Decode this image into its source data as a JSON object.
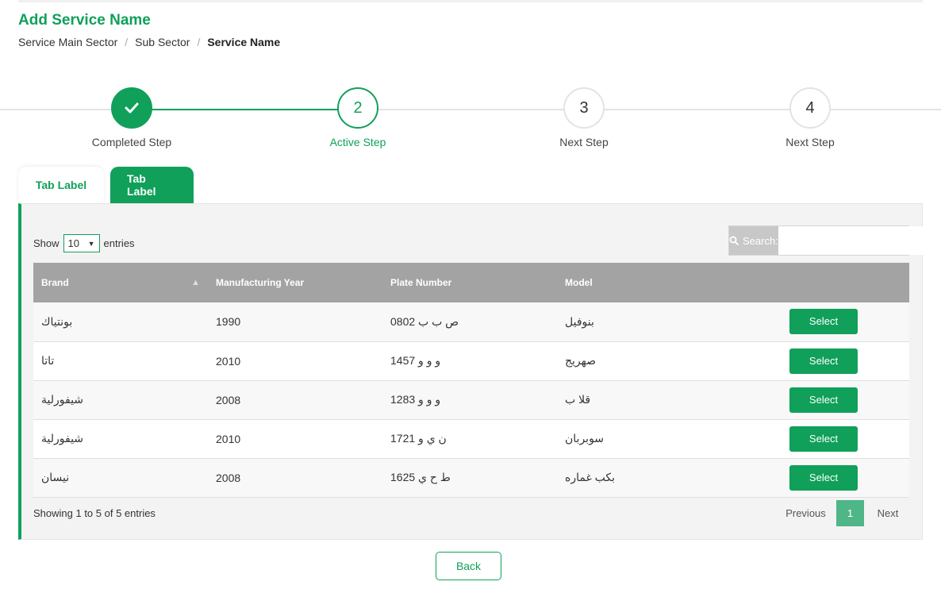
{
  "header": {
    "title": "Add Service Name",
    "breadcrumb": [
      "Service Main Sector",
      "Sub Sector",
      "Service Name"
    ]
  },
  "stepper": {
    "steps": [
      {
        "label": "Completed Step",
        "state": "completed",
        "icon": "check-icon"
      },
      {
        "label": "Active Step",
        "state": "active",
        "number": "2"
      },
      {
        "label": "Next Step",
        "state": "next",
        "number": "3"
      },
      {
        "label": "Next Step",
        "state": "next",
        "number": "4"
      }
    ]
  },
  "tabs": [
    {
      "label": "Tab Label"
    },
    {
      "label": "Tab Label"
    }
  ],
  "table_controls": {
    "show_label": "Show",
    "page_length": "10",
    "entries_label": "entries",
    "search_label": "Search:",
    "search_value": ""
  },
  "table": {
    "columns": [
      "Brand",
      "Manufacturing Year",
      "Plate Number",
      "Model"
    ],
    "rows": [
      {
        "brand": "بونتياك",
        "year": "1990",
        "plate": "ص ب ب 0802",
        "model": "بنوفيل",
        "action": "Select"
      },
      {
        "brand": "تاتا",
        "year": "2010",
        "plate": "و و و 1457",
        "model": "صهريج",
        "action": "Select"
      },
      {
        "brand": "شيفورلية",
        "year": "2008",
        "plate": "و و و 1283",
        "model": "قلا ب",
        "action": "Select"
      },
      {
        "brand": "شيفورلية",
        "year": "2010",
        "plate": "ن ي و 1721",
        "model": "سوبربان",
        "action": "Select"
      },
      {
        "brand": "نيسان",
        "year": "2008",
        "plate": "ط ح ي 1625",
        "model": "بكب غماره",
        "action": "Select"
      }
    ]
  },
  "footer": {
    "info": "Showing 1 to 5 of 5 entries",
    "previous": "Previous",
    "current_page": "1",
    "next": "Next"
  },
  "back_label": "Back",
  "colors": {
    "brand_green": "#10a05a",
    "header_grey": "#a3a3a3"
  }
}
